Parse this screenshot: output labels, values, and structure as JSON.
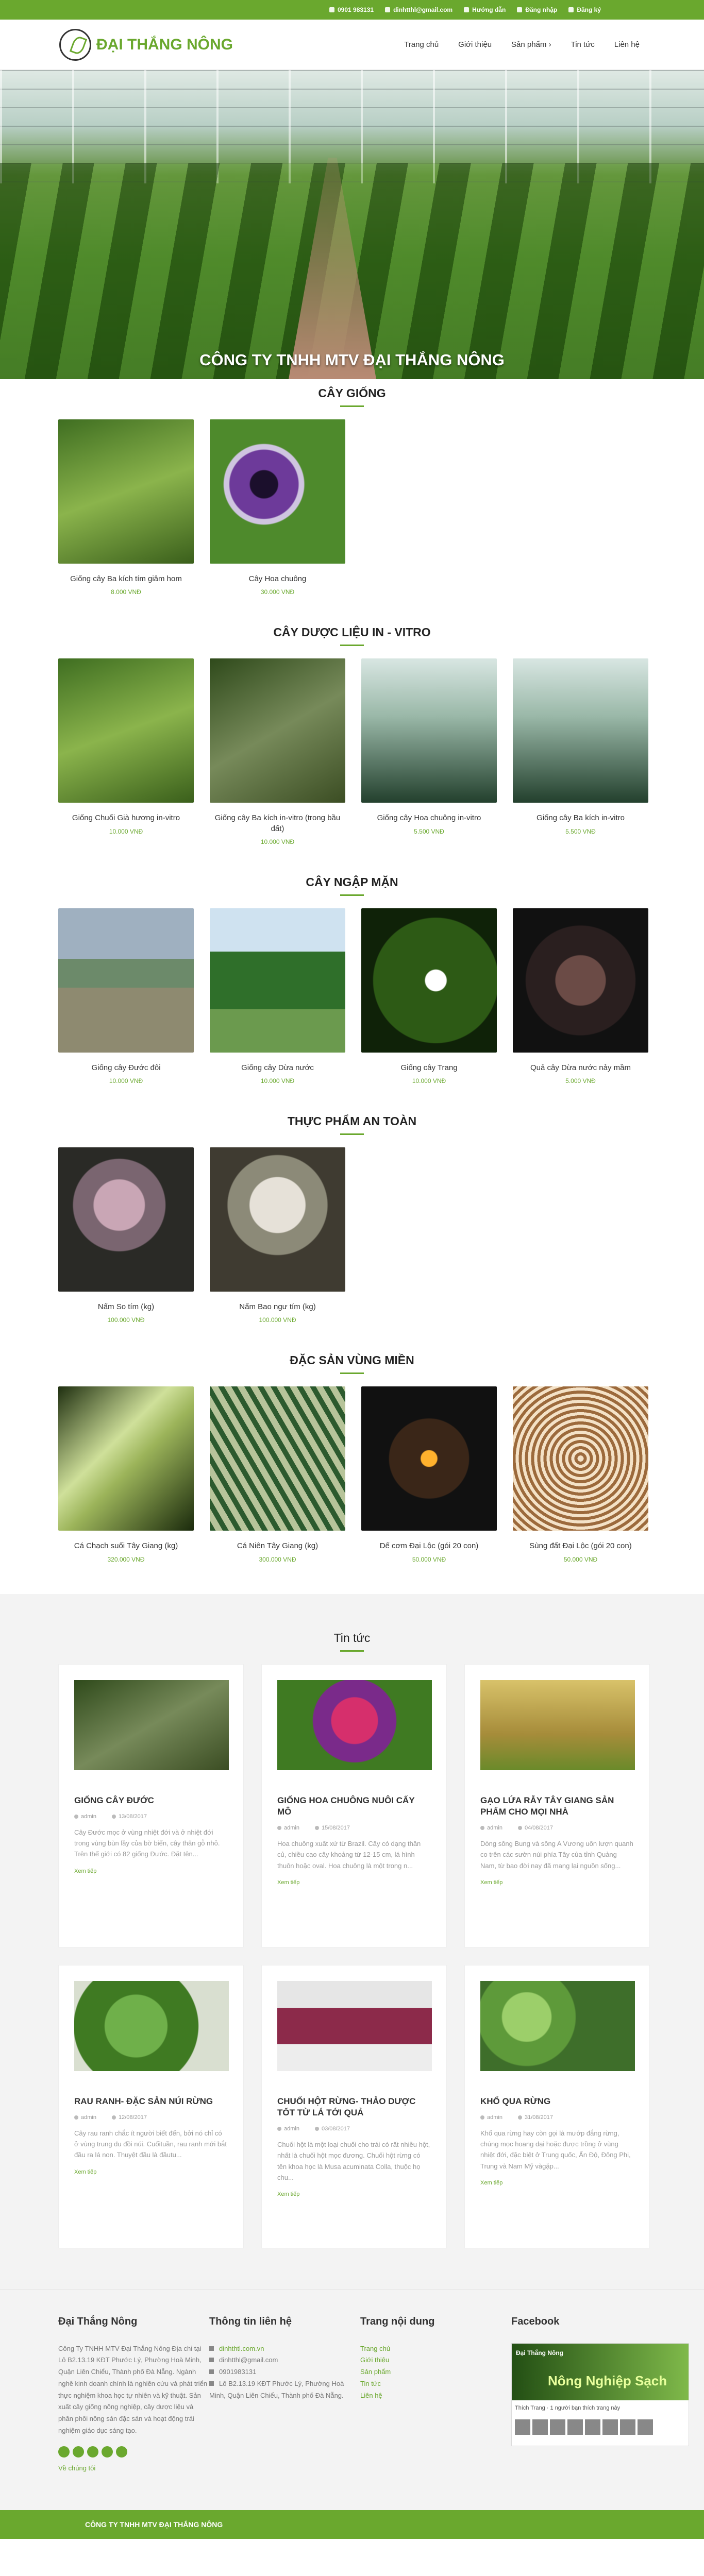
{
  "topbar": {
    "phone": "0901 983131",
    "email": "dinhtthl@gmail.com",
    "guide": "Hướng dẫn",
    "login": "Đăng nhập",
    "register": "Đăng ký"
  },
  "brand": {
    "name": "ĐẠI THẮNG NÔNG"
  },
  "nav": [
    "Trang chủ",
    "Giới thiệu",
    "Sản phẩm",
    "Tin tức",
    "Liên hệ"
  ],
  "hero": {
    "title": "CÔNG TY TNHH MTV ĐẠI THẮNG NÔNG"
  },
  "sections": [
    {
      "title": "CÂY GIỐNG",
      "products": [
        {
          "name": "Giống cây Ba kích tím giâm hom",
          "price": "8.000 VNĐ",
          "img": "ph-green"
        },
        {
          "name": "Cây Hoa chuông",
          "price": "30.000 VNĐ",
          "img": "ph-purple"
        }
      ]
    },
    {
      "title": "CÂY DƯỢC LIỆU IN - VITRO",
      "products": [
        {
          "name": "Giống Chuối Già hương in-vitro",
          "price": "10.000 VNĐ",
          "img": "ph-green"
        },
        {
          "name": "Giống cây Ba kích in-vitro (trong bầu đất)",
          "price": "10.000 VNĐ",
          "img": "ph-dry"
        },
        {
          "name": "Giống cây Hoa chuông in-vitro",
          "price": "5.500 VNĐ",
          "img": "ph-lab"
        },
        {
          "name": "Giống cây Ba kích in-vitro",
          "price": "5.500 VNĐ",
          "img": "ph-lab"
        }
      ]
    },
    {
      "title": "CÂY NGẬP MẶN",
      "products": [
        {
          "name": "Giống cây Đước đôi",
          "price": "10.000 VNĐ",
          "img": "ph-water"
        },
        {
          "name": "Giống cây Dừa nước",
          "price": "10.000 VNĐ",
          "img": "ph-hill"
        },
        {
          "name": "Giống cây Trang",
          "price": "10.000 VNĐ",
          "img": "ph-flower"
        },
        {
          "name": "Quả cây Dừa nước nảy mầm",
          "price": "5.000 VNĐ",
          "img": "ph-dark"
        }
      ]
    },
    {
      "title": "THỰC PHẨM AN TOÀN",
      "products": [
        {
          "name": "Nấm So tím (kg)",
          "price": "100.000 VNĐ",
          "img": "ph-mush"
        },
        {
          "name": "Nấm Bao ngư tím (kg)",
          "price": "100.000 VNĐ",
          "img": "ph-mush2"
        }
      ]
    },
    {
      "title": "ĐẶC SẢN VÙNG MIỀN",
      "products": [
        {
          "name": "Cá Chạch suối Tây Giang (kg)",
          "price": "320.000 VNĐ",
          "img": "ph-fish1"
        },
        {
          "name": "Cá Niên Tây Giang (kg)",
          "price": "300.000 VNĐ",
          "img": "ph-fish2"
        },
        {
          "name": "Dế cơm Đại Lộc (gói 20 con)",
          "price": "50.000 VNĐ",
          "img": "ph-fish3"
        },
        {
          "name": "Sùng đất Đại Lộc (gói 20 con)",
          "price": "50.000 VNĐ",
          "img": "ph-worm"
        }
      ]
    }
  ],
  "news": {
    "title": "Tin tức",
    "items": [
      {
        "title": "GIỐNG CÂY ĐƯỚC",
        "author": "admin",
        "date": "13/08/2017",
        "excerpt": "Cây Đước mọc ở vùng nhiệt đới và ở nhiệt đới trong vùng bùn lầy của bờ biển, cây thân gỗ nhỏ. Trên thế giới có 82 giống Đước. Đặt tên...",
        "more": "Xem tiếp",
        "img": "ph-dry"
      },
      {
        "title": "GIỐNG HOA CHUÔNG NUÔI CẤY MÔ",
        "author": "admin",
        "date": "15/08/2017",
        "excerpt": "Hoa chuông xuất xứ từ Brazil. Cây có dạng thân củ, chiều cao cây khoảng từ 12-15 cm, lá hình thuôn hoặc oval. Hoa chuông là một trong n...",
        "more": "Xem tiếp",
        "img": "ph-hib"
      },
      {
        "title": "GẠO LỨA RẪY TÂY GIANG SẢN PHẨM CHO MỌI NHÀ",
        "author": "admin",
        "date": "04/08/2017",
        "excerpt": "Dòng sông Bung và sông A Vương uốn lượn quanh co trên các sườn núi phía Tây của tỉnh Quảng Nam, từ bao đời nay đã mang lại nguồn sống...",
        "more": "Xem tiếp",
        "img": "ph-rice"
      },
      {
        "title": "RAU RANH- ĐẶC SẢN NÚI RỪNG",
        "author": "admin",
        "date": "12/08/2017",
        "excerpt": "Cây rau ranh chắc ít người biết đến, bởi nó chỉ có ở vùng trung du đồi núi. Cuốituần, rau ranh mới bắt đầu ra lá non. Thuyệt đầu là đầutu...",
        "more": "Xem tiếp",
        "img": "ph-veg"
      },
      {
        "title": "CHUỐI HỘT RỪNG- THẢO DƯỢC TỐT TỪ LÁ TỚI QUẢ",
        "author": "admin",
        "date": "03/08/2017",
        "excerpt": "Chuối hột là một loại chuối cho trái có rất nhiều hột, nhất là chuối hột mọc đương. Chuối hột rừng có tên khoa học là Musa acuminata Colla, thuộc họ chu...",
        "more": "Xem tiếp",
        "img": "ph-banana"
      },
      {
        "title": "KHỔ QUA RỪNG",
        "author": "admin",
        "date": "31/08/2017",
        "excerpt": "Khổ qua rừng hay còn gọi là mướp đắng rừng, chúng mọc hoang dại hoặc được trồng ở vùng nhiệt đới, đặc biệt ở Trung quốc, Ấn Độ, Đông Phi, Trung và Nam Mỹ vàgặp...",
        "more": "Xem tiếp",
        "img": "ph-bitter"
      }
    ]
  },
  "footer": {
    "about": {
      "title": "Đại Thắng Nông",
      "text": "Công Ty TNHH MTV Đại Thắng Nông Địa chỉ tại Lô B2.13.19 KĐT Phước Lý, Phường Hoà Minh, Quận Liên Chiểu, Thành phố Đà Nẵng. Ngành nghề kinh doanh chính là nghiên cứu và phát triển thực nghiệm khoa học tự nhiên và kỹ thuật. Sản xuất cây giống nông nghiệp, cây dược liệu và phân phối nông sản đặc sản và hoạt động trải nghiệm giáo dục sáng tạo.",
      "more": "Về chúng tôi"
    },
    "contact": {
      "title": "Thông tin liên hệ",
      "web": "dinhthtl.com.vn",
      "email": "dinhtthl@gmail.com",
      "phone": "0901983131",
      "address": "Lô B2.13.19 KĐT Phước Lý, Phường Hoà Minh, Quận Liên Chiểu, Thành phố Đà Nẵng."
    },
    "links": {
      "title": "Trang nội dung",
      "items": [
        "Trang chủ",
        "Giới thiệu",
        "Sản phẩm",
        "Tin tức",
        "Liên hệ"
      ]
    },
    "facebook": {
      "title": "Facebook",
      "page": "Đại Thắng Nông",
      "brand": "Nông Nghiệp Sạch",
      "like": "Thích Trang",
      "followers": "1 người bạn thích trang này"
    },
    "copyright": "CÔNG TY TNHH MTV ĐẠI THẮNG NÔNG"
  },
  "colors": {
    "accent": "#6aa82e"
  }
}
